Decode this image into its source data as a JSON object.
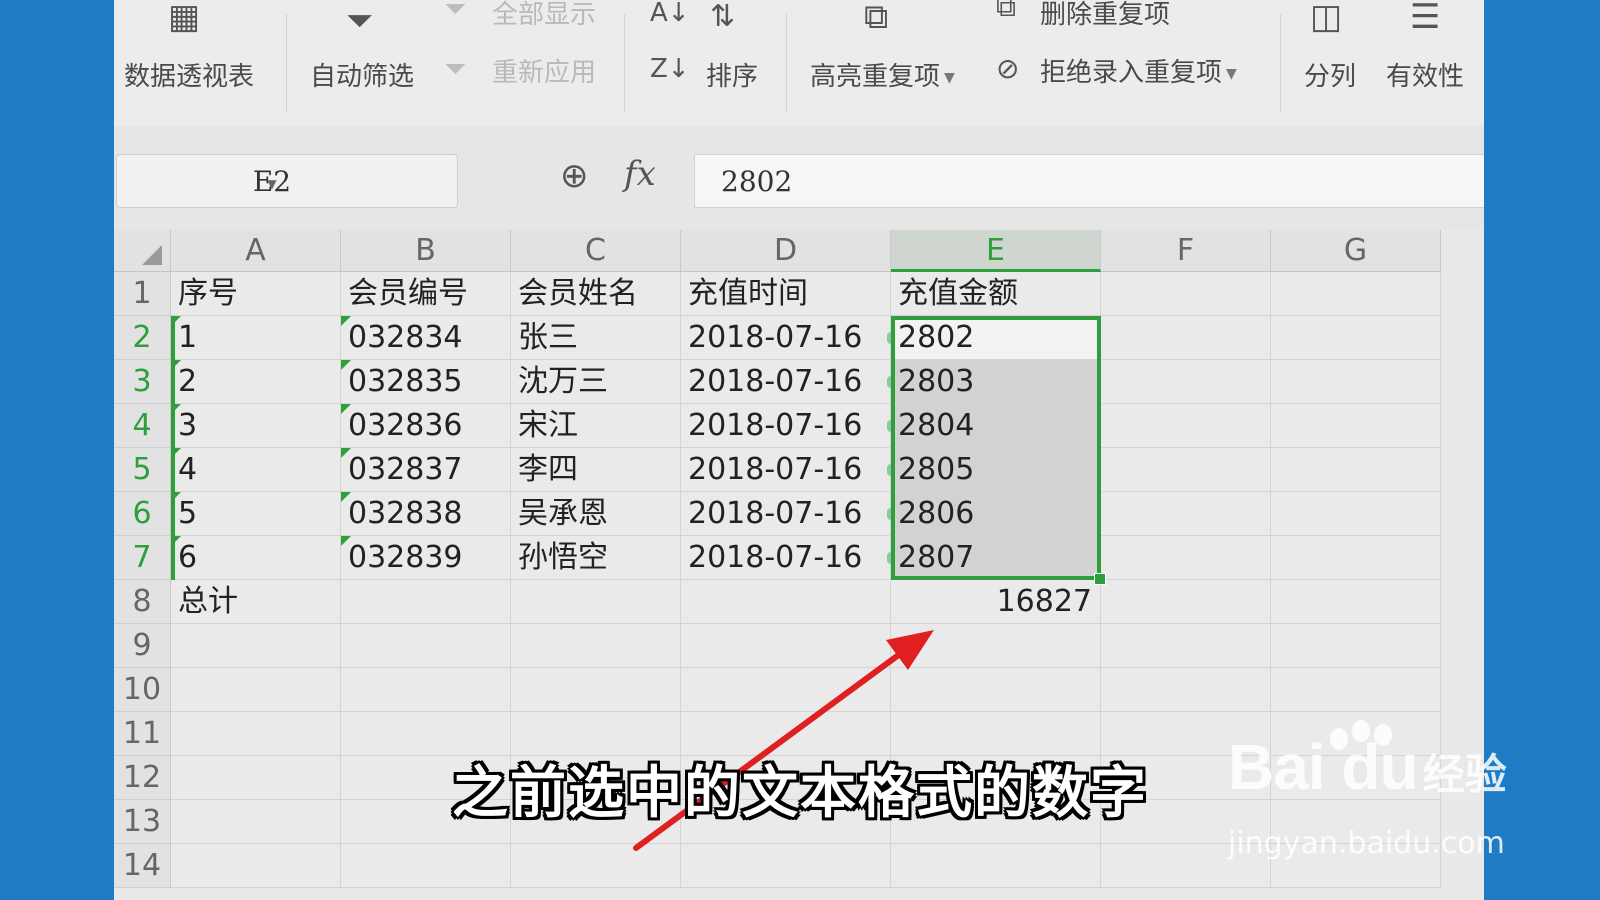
{
  "ribbon": {
    "pivot": "数据透视表",
    "autofilter": "自动筛选",
    "show_all": "全部显示",
    "reapply": "重新应用",
    "sort": "排序",
    "highlight_dup": "高亮重复项",
    "remove_dup": "删除重复项",
    "reject_dup": "拒绝录入重复项",
    "split": "分列",
    "validation": "有效性"
  },
  "formula_bar": {
    "name_box": "E2",
    "fx_label": "fx",
    "value": "2802"
  },
  "columns": [
    "A",
    "B",
    "C",
    "D",
    "E",
    "F",
    "G"
  ],
  "selected_column": "E",
  "rows": [
    {
      "n": "1",
      "a": "序号",
      "b": "会员编号",
      "c": "会员姓名",
      "d": "充值时间",
      "e": "充值金额"
    },
    {
      "n": "2",
      "a": "1",
      "b": "032834",
      "c": "张三",
      "d": "2018-07-16",
      "e": "2802"
    },
    {
      "n": "3",
      "a": "2",
      "b": "032835",
      "c": "沈万三",
      "d": "2018-07-16",
      "e": "2803"
    },
    {
      "n": "4",
      "a": "3",
      "b": "032836",
      "c": "宋江",
      "d": "2018-07-16",
      "e": "2804"
    },
    {
      "n": "5",
      "a": "4",
      "b": "032837",
      "c": "李四",
      "d": "2018-07-16",
      "e": "2805"
    },
    {
      "n": "6",
      "a": "5",
      "b": "032838",
      "c": "吴承恩",
      "d": "2018-07-16",
      "e": "2806"
    },
    {
      "n": "7",
      "a": "6",
      "b": "032839",
      "c": "孙悟空",
      "d": "2018-07-16",
      "e": "2807"
    },
    {
      "n": "8",
      "a": "总计",
      "b": "",
      "c": "",
      "d": "",
      "e": "16827"
    },
    {
      "n": "9"
    },
    {
      "n": "10"
    },
    {
      "n": "11"
    },
    {
      "n": "12"
    },
    {
      "n": "13"
    },
    {
      "n": "14"
    }
  ],
  "subtitle": "之前选中的文本格式的数字",
  "watermark": {
    "logo": "Bai du",
    "label": "经验",
    "url": "jingyan.baidu.com"
  },
  "colors": {
    "selection": "#2f9e3c",
    "arrow": "#e02020",
    "background": "#1e7bc4"
  }
}
